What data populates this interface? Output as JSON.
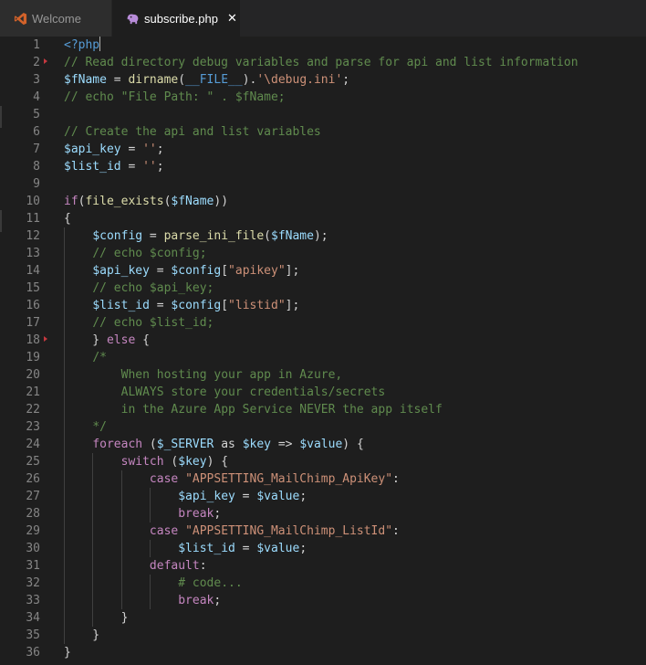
{
  "tabs": [
    {
      "label": "Welcome",
      "icon": "vscode-logo-icon",
      "active": false
    },
    {
      "label": "subscribe.php",
      "icon": "php-elephant-icon",
      "active": true,
      "close": "✕"
    }
  ],
  "colors": {
    "background": "#1e1e1e",
    "tabbar": "#252526",
    "keyword": "#c586c0",
    "variable": "#9cdcfe",
    "function": "#dcdcaa",
    "string": "#ce9178",
    "comment": "#608b4e",
    "tag": "#569cd6",
    "plain": "#d4d4d4",
    "line_number": "#858585",
    "fold_marker": "#c5383f"
  },
  "fold_markers": [
    2,
    18
  ],
  "lines": [
    {
      "n": "1",
      "tokens": [
        [
          "tag",
          "<?php"
        ]
      ],
      "cursor": true
    },
    {
      "n": "2",
      "tokens": [
        [
          "cmt",
          "// Read directory debug variables and parse for api and list information"
        ]
      ]
    },
    {
      "n": "3",
      "tokens": [
        [
          "var",
          "$fName"
        ],
        [
          "pl",
          " = "
        ],
        [
          "fn",
          "dirname"
        ],
        [
          "pl",
          "("
        ],
        [
          "const",
          "__FILE__"
        ],
        [
          "pl",
          ")."
        ],
        [
          "str",
          "'\\debug.ini'"
        ],
        [
          "pl",
          ";"
        ]
      ]
    },
    {
      "n": "4",
      "tokens": [
        [
          "cmt",
          "// echo \"File Path: \" . $fName;"
        ]
      ]
    },
    {
      "n": "5",
      "tokens": []
    },
    {
      "n": "6",
      "tokens": [
        [
          "cmt",
          "// Create the api and list variables"
        ]
      ]
    },
    {
      "n": "7",
      "tokens": [
        [
          "var",
          "$api_key"
        ],
        [
          "pl",
          " = "
        ],
        [
          "str",
          "''"
        ],
        [
          "pl",
          ";"
        ]
      ]
    },
    {
      "n": "8",
      "tokens": [
        [
          "var",
          "$list_id"
        ],
        [
          "pl",
          " = "
        ],
        [
          "str",
          "''"
        ],
        [
          "pl",
          ";"
        ]
      ]
    },
    {
      "n": "9",
      "tokens": []
    },
    {
      "n": "10",
      "tokens": [
        [
          "kw",
          "if"
        ],
        [
          "pl",
          "("
        ],
        [
          "fn",
          "file_exists"
        ],
        [
          "pl",
          "("
        ],
        [
          "var",
          "$fName"
        ],
        [
          "pl",
          "))"
        ]
      ]
    },
    {
      "n": "11",
      "tokens": [
        [
          "pl",
          "{"
        ]
      ]
    },
    {
      "n": "12",
      "tokens": [
        [
          "pl",
          "    "
        ],
        [
          "var",
          "$config"
        ],
        [
          "pl",
          " = "
        ],
        [
          "fn",
          "parse_ini_file"
        ],
        [
          "pl",
          "("
        ],
        [
          "var",
          "$fName"
        ],
        [
          "pl",
          ");"
        ]
      ]
    },
    {
      "n": "13",
      "tokens": [
        [
          "pl",
          "    "
        ],
        [
          "cmt",
          "// echo $config;"
        ]
      ]
    },
    {
      "n": "14",
      "tokens": [
        [
          "pl",
          "    "
        ],
        [
          "var",
          "$api_key"
        ],
        [
          "pl",
          " = "
        ],
        [
          "var",
          "$config"
        ],
        [
          "pl",
          "["
        ],
        [
          "str",
          "\"apikey\""
        ],
        [
          "pl",
          "];"
        ]
      ]
    },
    {
      "n": "15",
      "tokens": [
        [
          "pl",
          "    "
        ],
        [
          "cmt",
          "// echo $api_key;"
        ]
      ]
    },
    {
      "n": "16",
      "tokens": [
        [
          "pl",
          "    "
        ],
        [
          "var",
          "$list_id"
        ],
        [
          "pl",
          " = "
        ],
        [
          "var",
          "$config"
        ],
        [
          "pl",
          "["
        ],
        [
          "str",
          "\"listid\""
        ],
        [
          "pl",
          "];"
        ]
      ]
    },
    {
      "n": "17",
      "tokens": [
        [
          "pl",
          "    "
        ],
        [
          "cmt",
          "// echo $list_id;"
        ]
      ]
    },
    {
      "n": "18",
      "tokens": [
        [
          "pl",
          "    } "
        ],
        [
          "kw",
          "else"
        ],
        [
          "pl",
          " {"
        ]
      ]
    },
    {
      "n": "19",
      "tokens": [
        [
          "pl",
          "    "
        ],
        [
          "cmt",
          "/*"
        ]
      ]
    },
    {
      "n": "20",
      "tokens": [
        [
          "pl",
          "        "
        ],
        [
          "cmt",
          "When hosting your app in Azure,"
        ]
      ]
    },
    {
      "n": "21",
      "tokens": [
        [
          "pl",
          "        "
        ],
        [
          "cmt",
          "ALWAYS store your credentials/secrets"
        ]
      ]
    },
    {
      "n": "22",
      "tokens": [
        [
          "pl",
          "        "
        ],
        [
          "cmt",
          "in the Azure App Service NEVER the app itself"
        ]
      ]
    },
    {
      "n": "23",
      "tokens": [
        [
          "pl",
          "    "
        ],
        [
          "cmt",
          "*/"
        ]
      ]
    },
    {
      "n": "24",
      "tokens": [
        [
          "pl",
          "    "
        ],
        [
          "kw",
          "foreach"
        ],
        [
          "pl",
          " ("
        ],
        [
          "var",
          "$_SERVER"
        ],
        [
          "pl",
          " as "
        ],
        [
          "var",
          "$key"
        ],
        [
          "pl",
          " => "
        ],
        [
          "var",
          "$value"
        ],
        [
          "pl",
          ") {"
        ]
      ]
    },
    {
      "n": "25",
      "tokens": [
        [
          "pl",
          "        "
        ],
        [
          "kw",
          "switch"
        ],
        [
          "pl",
          " ("
        ],
        [
          "var",
          "$key"
        ],
        [
          "pl",
          ") {"
        ]
      ]
    },
    {
      "n": "26",
      "tokens": [
        [
          "pl",
          "            "
        ],
        [
          "kw",
          "case"
        ],
        [
          "pl",
          " "
        ],
        [
          "str",
          "\"APPSETTING_MailChimp_ApiKey\""
        ],
        [
          "pl",
          ":"
        ]
      ]
    },
    {
      "n": "27",
      "tokens": [
        [
          "pl",
          "                "
        ],
        [
          "var",
          "$api_key"
        ],
        [
          "pl",
          " = "
        ],
        [
          "var",
          "$value"
        ],
        [
          "pl",
          ";"
        ]
      ]
    },
    {
      "n": "28",
      "tokens": [
        [
          "pl",
          "                "
        ],
        [
          "kw",
          "break"
        ],
        [
          "pl",
          ";"
        ]
      ]
    },
    {
      "n": "29",
      "tokens": [
        [
          "pl",
          "            "
        ],
        [
          "kw",
          "case"
        ],
        [
          "pl",
          " "
        ],
        [
          "str",
          "\"APPSETTING_MailChimp_ListId\""
        ],
        [
          "pl",
          ":"
        ]
      ]
    },
    {
      "n": "30",
      "tokens": [
        [
          "pl",
          "                "
        ],
        [
          "var",
          "$list_id"
        ],
        [
          "pl",
          " = "
        ],
        [
          "var",
          "$value"
        ],
        [
          "pl",
          ";"
        ]
      ]
    },
    {
      "n": "31",
      "tokens": [
        [
          "pl",
          "            "
        ],
        [
          "kw",
          "default"
        ],
        [
          "pl",
          ":"
        ]
      ]
    },
    {
      "n": "32",
      "tokens": [
        [
          "pl",
          "                "
        ],
        [
          "cmt",
          "# code..."
        ]
      ]
    },
    {
      "n": "33",
      "tokens": [
        [
          "pl",
          "                "
        ],
        [
          "kw",
          "break"
        ],
        [
          "pl",
          ";"
        ]
      ]
    },
    {
      "n": "34",
      "tokens": [
        [
          "pl",
          "        }"
        ]
      ]
    },
    {
      "n": "35",
      "tokens": [
        [
          "pl",
          "    }"
        ]
      ]
    },
    {
      "n": "36",
      "tokens": [
        [
          "pl",
          "}"
        ]
      ]
    }
  ]
}
